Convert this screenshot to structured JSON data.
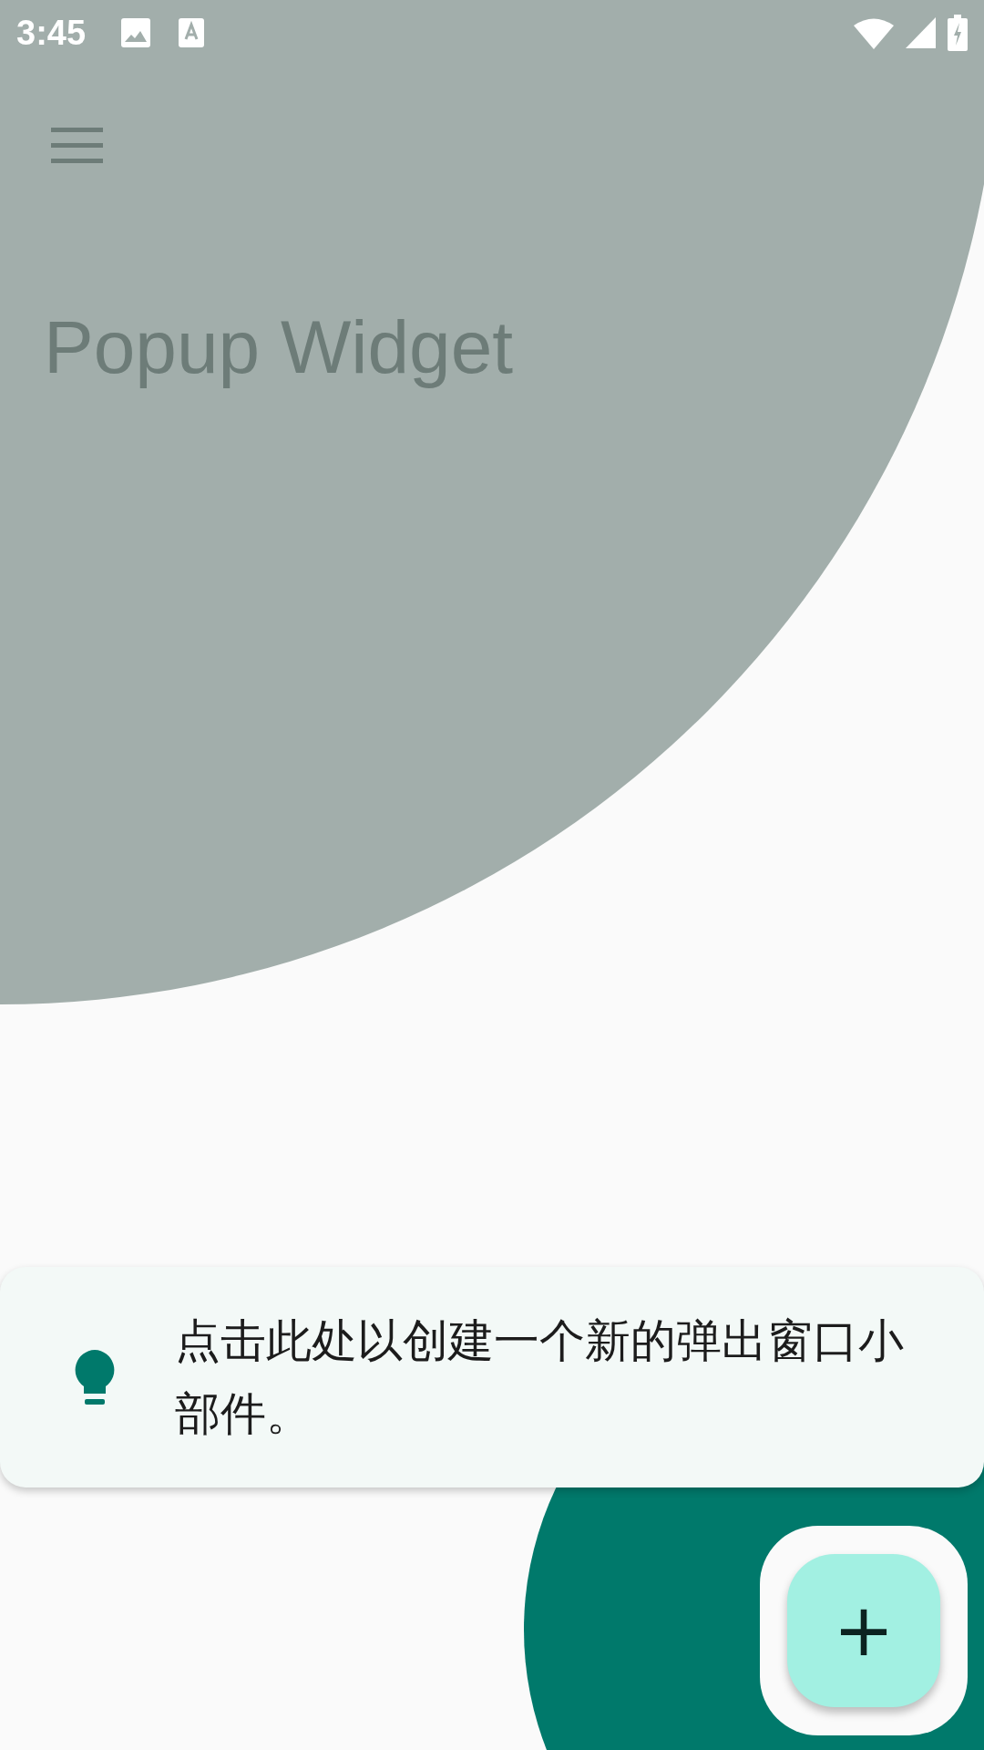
{
  "status_bar": {
    "time": "3:45"
  },
  "app_bar": {
    "title": "Popup Widget"
  },
  "tip": {
    "text": "点击此处以创建一个新的弹出窗口小部件。"
  },
  "fab": {
    "label": "+"
  }
}
